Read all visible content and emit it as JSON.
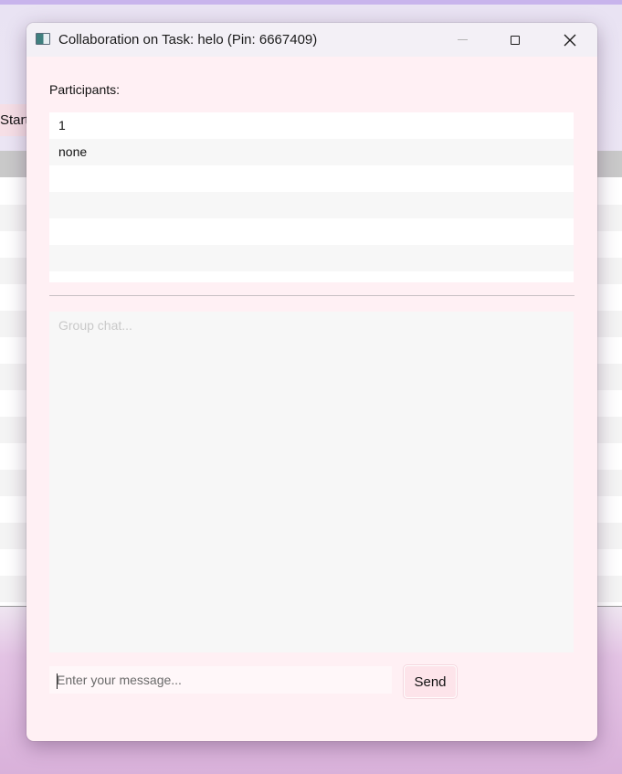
{
  "background_app": {
    "start_label": "Start"
  },
  "window": {
    "title": "Collaboration on Task: helo (Pin: 6667409)",
    "controls": {
      "minimize_icon": "minimize-icon",
      "maximize_icon": "maximize-icon",
      "close_icon": "close-icon"
    }
  },
  "participants": {
    "label": "Participants:",
    "items": [
      "1",
      "none",
      "",
      "",
      "",
      "",
      ""
    ]
  },
  "chat": {
    "placeholder": "Group chat...",
    "value": ""
  },
  "message": {
    "placeholder": "Enter your message...",
    "value": "",
    "send_label": "Send"
  },
  "colors": {
    "window_bg": "#fff0f4",
    "titlebar_bg": "#f3f0f6",
    "send_button_bg": "#fde4ea",
    "chat_bg": "#f7f7f7"
  }
}
